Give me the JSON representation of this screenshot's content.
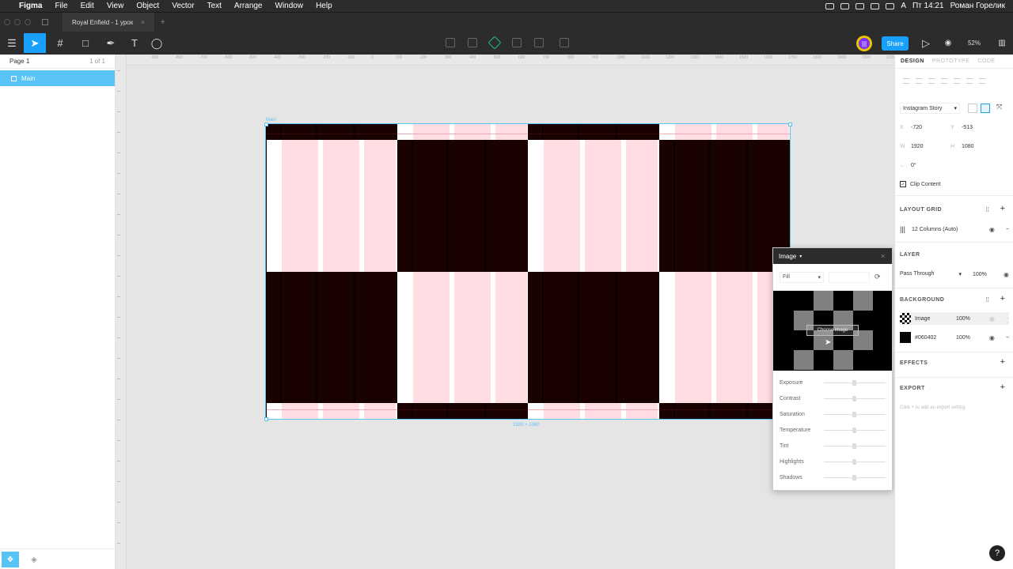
{
  "menubar": {
    "apple": "",
    "app": "Figma",
    "items": [
      "File",
      "Edit",
      "View",
      "Object",
      "Vector",
      "Text",
      "Arrange",
      "Window",
      "Help"
    ],
    "clock": "Пт 14:21",
    "user": "Роман Горелик",
    "input_lang": "A"
  },
  "tabs": {
    "file_title": "Royal Enfield - 1 урок",
    "close": "×",
    "new": "+"
  },
  "toolbar": {
    "menu_icon": "☰",
    "move_tool": "➤",
    "frame_tool": "#",
    "shape_tool": "□",
    "pen_tool": "✒",
    "text_tool": "T",
    "comment_tool": "◯",
    "avatar_initials": "|||",
    "share_label": "Share",
    "play_icon": "▷",
    "eye_icon": "◉",
    "zoom": "52%",
    "library_icon": "▥"
  },
  "left_panel": {
    "page_name": "Page 1",
    "page_count": "1 of 1",
    "layer_name": "Main"
  },
  "canvas": {
    "frame_label": "Main",
    "frame_size": "1920 × 1080",
    "colors": {
      "dark": "#1a0201",
      "pink": "#ffdde2",
      "pink_light": "#ffe9ec",
      "white": "#ffffff",
      "blue": "#58c4f6"
    }
  },
  "image_popup": {
    "title": "Image",
    "fill_mode": "Fill",
    "choose_image": "Choose image",
    "adjustments": [
      "Exposure",
      "Contrast",
      "Saturation",
      "Temperature",
      "Tint",
      "Highlights",
      "Shadows"
    ]
  },
  "right_panel": {
    "tabs": [
      "DESIGN",
      "PROTOTYPE",
      "CODE"
    ],
    "frame_preset": "Instagram Story",
    "x": "-720",
    "y": "-513",
    "w": "1920",
    "h": "1080",
    "rotation": "0°",
    "clip_content": "Clip Content",
    "layout_grid_title": "LAYOUT GRID",
    "layout_grid_value": "12 Columns (Auto)",
    "layer_title": "LAYER",
    "blend_mode": "Pass Through",
    "layer_opacity": "100%",
    "background_title": "BACKGROUND",
    "bg_fills": [
      {
        "name": "Image",
        "opacity": "100%"
      },
      {
        "name": "#060402",
        "opacity": "100%"
      }
    ],
    "effects_title": "EFFECTS",
    "export_title": "EXPORT",
    "export_hint": "Click + to add an export setting"
  },
  "help": "?"
}
